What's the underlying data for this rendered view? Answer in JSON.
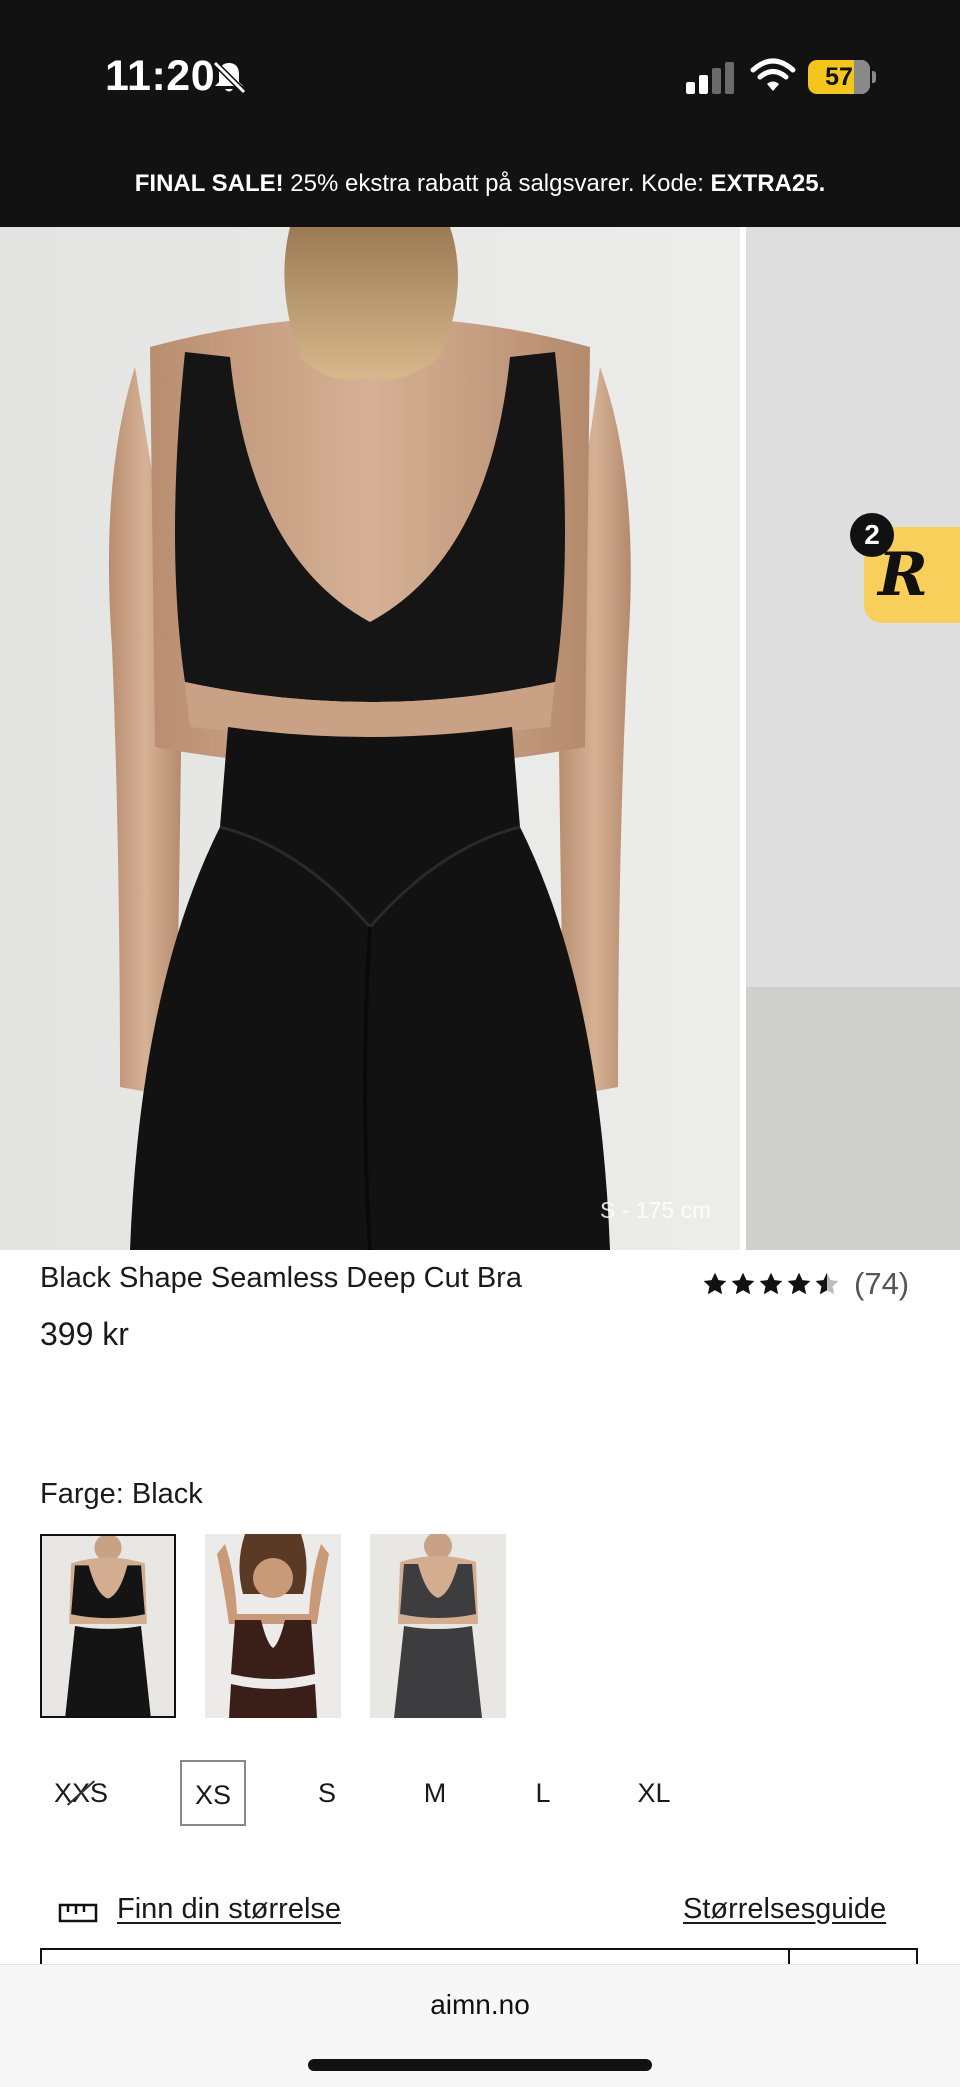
{
  "status_bar": {
    "time": "11:20",
    "battery_level": "57"
  },
  "promo_banner": {
    "bold_lead": "FINAL SALE!",
    "text": " 25% ekstra rabatt på salgsvarer. Kode: ",
    "code": "EXTRA25."
  },
  "gallery": {
    "model_caption": "S - 175 cm"
  },
  "reviews_widget": {
    "badge_count": "2",
    "logo": "R"
  },
  "product": {
    "title": "Black Shape Seamless Deep Cut Bra",
    "price": "399 kr",
    "rating": 4.5,
    "rating_count": "(74)"
  },
  "color": {
    "label": "Farge: Black",
    "swatches": [
      "black",
      "brown",
      "charcoal"
    ],
    "selected_index": 0
  },
  "sizes": {
    "options": [
      "XXS",
      "XS",
      "S",
      "M",
      "L",
      "XL"
    ],
    "selected": "XS",
    "out_of_stock": [
      "XXS"
    ]
  },
  "links": {
    "size_finder": "Finn din størrelse",
    "size_guide": "Størrelsesguide"
  },
  "browser": {
    "url": "aimn.no"
  },
  "colors": {
    "banner_bg": "#121212",
    "reviews_yellow": "#f7cf5a",
    "battery_yellow": "#f3c51d"
  }
}
